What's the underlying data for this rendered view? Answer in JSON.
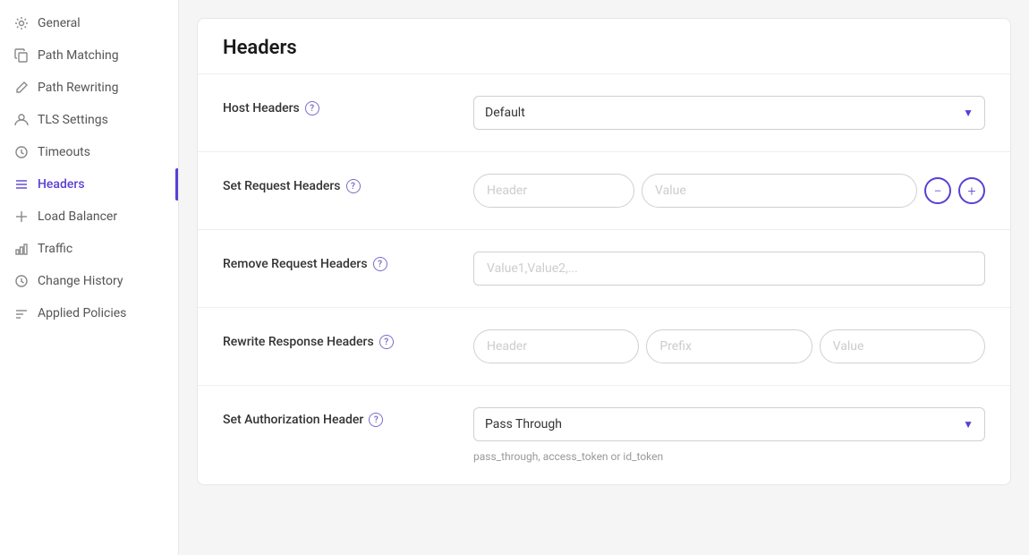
{
  "sidebar": {
    "items": [
      {
        "id": "general",
        "label": "General",
        "icon": "gear",
        "active": false
      },
      {
        "id": "path-matching",
        "label": "Path Matching",
        "icon": "copy",
        "active": false
      },
      {
        "id": "path-rewriting",
        "label": "Path Rewriting",
        "icon": "pencil",
        "active": false
      },
      {
        "id": "tls-settings",
        "label": "TLS Settings",
        "icon": "person",
        "active": false
      },
      {
        "id": "timeouts",
        "label": "Timeouts",
        "icon": "clock",
        "active": false
      },
      {
        "id": "headers",
        "label": "Headers",
        "icon": "lines",
        "active": true
      },
      {
        "id": "load-balancer",
        "label": "Load Balancer",
        "icon": "cross",
        "active": false
      },
      {
        "id": "traffic",
        "label": "Traffic",
        "icon": "bar-chart",
        "active": false
      },
      {
        "id": "change-history",
        "label": "Change History",
        "icon": "clock",
        "active": false
      },
      {
        "id": "applied-policies",
        "label": "Applied Policies",
        "icon": "applied",
        "active": false
      }
    ]
  },
  "main": {
    "title": "Headers",
    "sections": [
      {
        "id": "host-headers",
        "label": "Host Headers",
        "type": "dropdown",
        "value": "Default",
        "has_help": true
      },
      {
        "id": "set-request-headers",
        "label": "Set Request Headers",
        "type": "header-value",
        "header_placeholder": "Header",
        "value_placeholder": "Value",
        "has_help": true
      },
      {
        "id": "remove-request-headers",
        "label": "Remove Request Headers",
        "type": "text",
        "placeholder": "Value1,Value2,...",
        "has_help": true
      },
      {
        "id": "rewrite-response-headers",
        "label": "Rewrite Response Headers",
        "type": "three-inputs",
        "placeholder1": "Header",
        "placeholder2": "Prefix",
        "placeholder3": "Value",
        "has_help": true
      },
      {
        "id": "set-authorization-header",
        "label": "Set Authorization Header",
        "type": "dropdown-with-hint",
        "value": "Pass Through",
        "hint": "pass_through, access_token or id_token",
        "has_help": true
      }
    ]
  }
}
